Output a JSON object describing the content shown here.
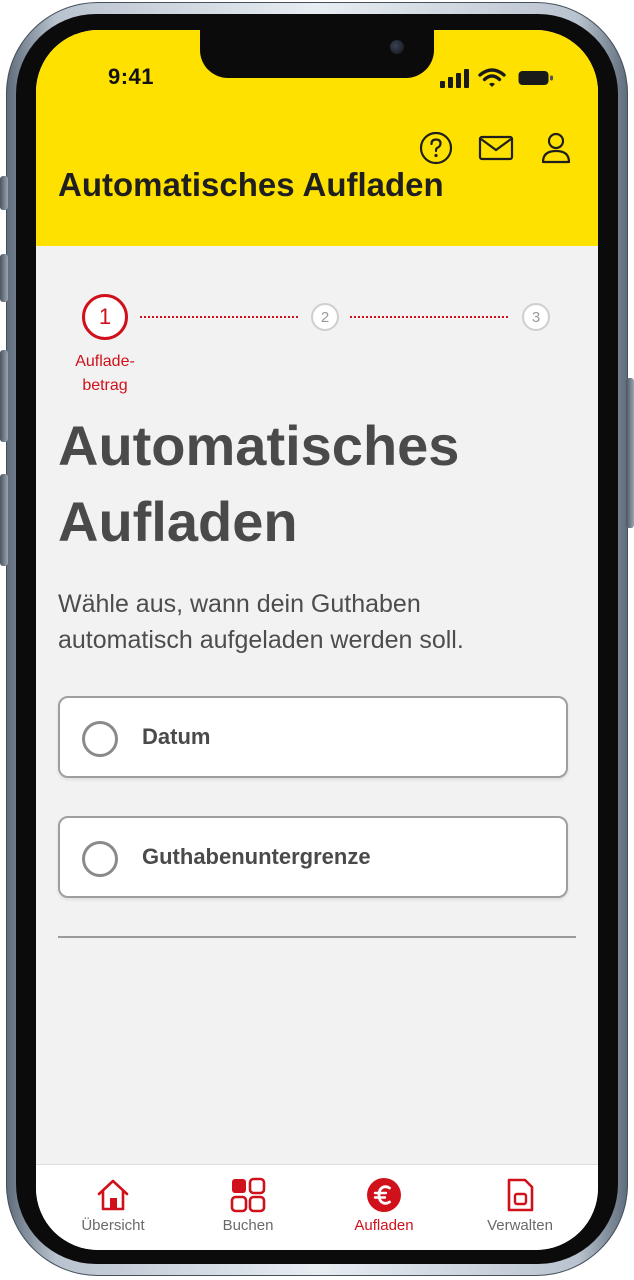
{
  "status_bar": {
    "time": "9:41",
    "icons": [
      "signal-icon",
      "wifi-icon",
      "battery-icon"
    ]
  },
  "header": {
    "title": "Automatisches Aufladen",
    "icons": [
      "help-icon",
      "mail-icon",
      "user-icon"
    ],
    "background_color": "#ffe100"
  },
  "stepper": {
    "current_step": "1",
    "current_label_line1": "Auflade-",
    "current_label_line2": "betrag",
    "step2": "2",
    "step3": "3",
    "accent_color": "#d0111b"
  },
  "main": {
    "title_line1": "Automatisches",
    "title_line2": "Aufladen",
    "description_line1": "Wähle aus, wann dein Guthaben",
    "description_line2": "automatisch aufgeladen werden soll.",
    "options": [
      {
        "label": "Datum",
        "selected": false
      },
      {
        "label": "Guthabenuntergrenze",
        "selected": false
      }
    ]
  },
  "bottom_nav": {
    "items": [
      {
        "label": "Übersicht",
        "icon": "home-icon",
        "active": false
      },
      {
        "label": "Buchen",
        "icon": "grid-icon",
        "active": false
      },
      {
        "label": "Aufladen",
        "icon": "euro-icon",
        "active": true
      },
      {
        "label": "Verwalten",
        "icon": "sim-card-icon",
        "active": false
      }
    ]
  }
}
